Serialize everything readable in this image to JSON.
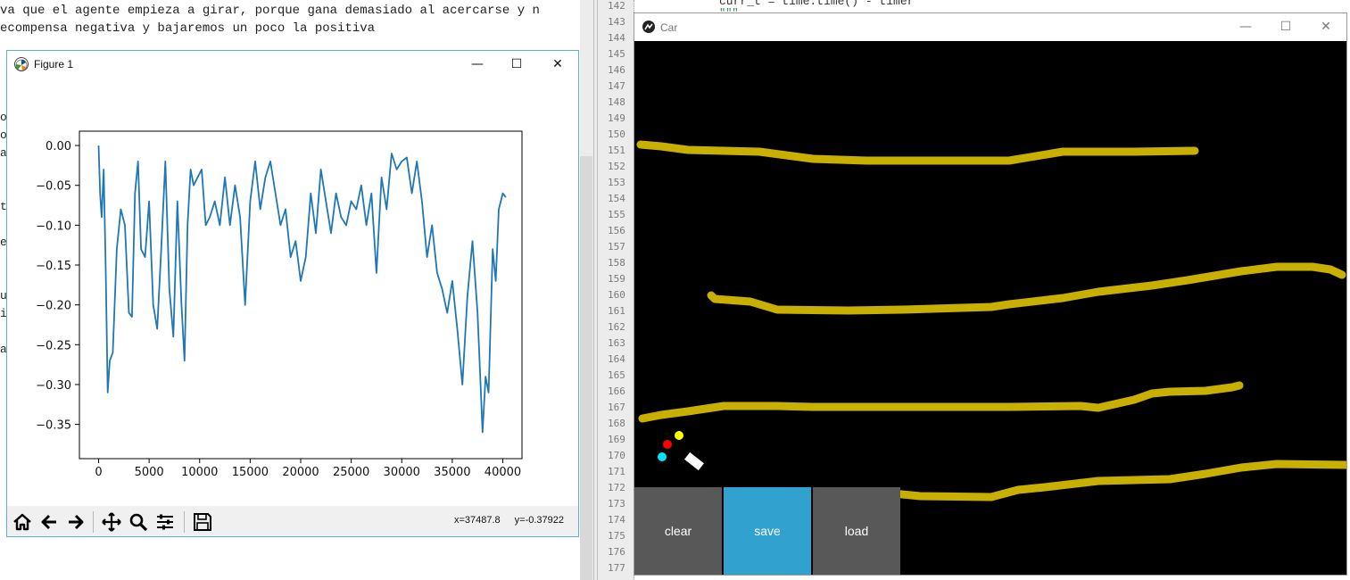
{
  "background_text": {
    "line1": "va que el agente empieza a girar, porque gana demasiado al acercarse y n",
    "line2": "ecompensa negativa y bajaremos un poco la positiva",
    "side_letters": [
      "o",
      "o",
      "a",
      "t",
      "e",
      "u",
      "i",
      "a"
    ]
  },
  "editor": {
    "line_numbers": [
      "142",
      "143",
      "144",
      "145",
      "146",
      "147",
      "148",
      "149",
      "150",
      "151",
      "152",
      "153",
      "154",
      "155",
      "156",
      "157",
      "158",
      "159",
      "160",
      "161",
      "162",
      "163",
      "164",
      "165",
      "166",
      "167",
      "168",
      "169",
      "170",
      "171",
      "172",
      "173",
      "174",
      "175",
      "176",
      "177"
    ],
    "code_line": "curr_t = time.time() - timer",
    "code_line2": "\"\"\""
  },
  "figure": {
    "title": "Figure 1",
    "minimize": "—",
    "maximize": "☐",
    "close": "✕",
    "coords": {
      "x": "x=37487.8",
      "y": "y=-0.37922"
    },
    "toolbar_icons": [
      "home-icon",
      "back-arrow-icon",
      "forward-arrow-icon",
      "pan-icon",
      "zoom-icon",
      "configure-icon",
      "save-icon"
    ]
  },
  "chart_data": {
    "type": "line",
    "xlim": [
      -1900,
      41900
    ],
    "ylim": [
      -0.393,
      0.018
    ],
    "xticks": [
      0,
      5000,
      10000,
      15000,
      20000,
      25000,
      30000,
      35000,
      40000
    ],
    "xtick_labels": [
      "0",
      "5000",
      "10000",
      "15000",
      "20000",
      "25000",
      "30000",
      "35000",
      "40000"
    ],
    "yticks": [
      0.0,
      -0.05,
      -0.1,
      -0.15,
      -0.2,
      -0.25,
      -0.3,
      -0.35
    ],
    "ytick_labels": [
      "0.00",
      "−0.05",
      "−0.10",
      "−0.15",
      "−0.20",
      "−0.25",
      "−0.30",
      "−0.35"
    ],
    "color": "#1f77b4",
    "series": [
      {
        "x": [
          0,
          150,
          300,
          500,
          700,
          900,
          1100,
          1400,
          1800,
          2200,
          2600,
          3000,
          3300,
          3600,
          3900,
          4200,
          4600,
          5000,
          5400,
          5800,
          6200,
          6600,
          7000,
          7400,
          7800,
          8200,
          8500,
          8800,
          9100,
          9400,
          9800,
          10200,
          10600,
          11000,
          11500,
          12000,
          12500,
          13000,
          13500,
          14000,
          14500,
          15000,
          15500,
          16000,
          16500,
          17000,
          17500,
          18000,
          18500,
          19000,
          19500,
          20000,
          20500,
          21000,
          21500,
          22000,
          22500,
          23000,
          23500,
          24000,
          24500,
          25000,
          25500,
          26000,
          26500,
          27000,
          27500,
          28000,
          28500,
          29000,
          29500,
          30000,
          30500,
          31000,
          31500,
          32000,
          32500,
          33000,
          33500,
          34000,
          34500,
          35000,
          35500,
          36000,
          36500,
          37000,
          37500,
          37800,
          38000,
          38300,
          38600,
          39000,
          39300,
          39600,
          40000,
          40300
        ],
        "y": [
          0.0,
          -0.06,
          -0.09,
          -0.03,
          -0.15,
          -0.31,
          -0.27,
          -0.26,
          -0.13,
          -0.08,
          -0.1,
          -0.21,
          -0.215,
          -0.06,
          -0.02,
          -0.13,
          -0.14,
          -0.07,
          -0.2,
          -0.23,
          -0.13,
          -0.02,
          -0.18,
          -0.24,
          -0.07,
          -0.2,
          -0.27,
          -0.1,
          -0.03,
          -0.05,
          -0.04,
          -0.03,
          -0.1,
          -0.09,
          -0.07,
          -0.1,
          -0.04,
          -0.1,
          -0.05,
          -0.09,
          -0.2,
          -0.07,
          -0.02,
          -0.08,
          -0.04,
          -0.02,
          -0.06,
          -0.1,
          -0.08,
          -0.14,
          -0.12,
          -0.17,
          -0.14,
          -0.06,
          -0.11,
          -0.03,
          -0.07,
          -0.11,
          -0.06,
          -0.09,
          -0.1,
          -0.07,
          -0.08,
          -0.05,
          -0.1,
          -0.06,
          -0.16,
          -0.04,
          -0.08,
          -0.01,
          -0.03,
          -0.02,
          -0.015,
          -0.06,
          -0.02,
          -0.07,
          -0.14,
          -0.1,
          -0.16,
          -0.18,
          -0.21,
          -0.17,
          -0.23,
          -0.3,
          -0.19,
          -0.12,
          -0.21,
          -0.3,
          -0.36,
          -0.29,
          -0.31,
          -0.13,
          -0.17,
          -0.08,
          -0.06,
          -0.065
        ]
      }
    ]
  },
  "car_window": {
    "title": "Car",
    "minimize": "—",
    "maximize": "☐",
    "close": "✕",
    "buttons": {
      "clear": "clear",
      "save": "save",
      "load": "load"
    },
    "colors": {
      "canvas": "#000000",
      "track": "#c9b000",
      "button_gray": "#585858",
      "button_blue": "#31a2d0"
    },
    "sensors": [
      "#ff0000",
      "#ffff00",
      "#00e5ff"
    ]
  }
}
